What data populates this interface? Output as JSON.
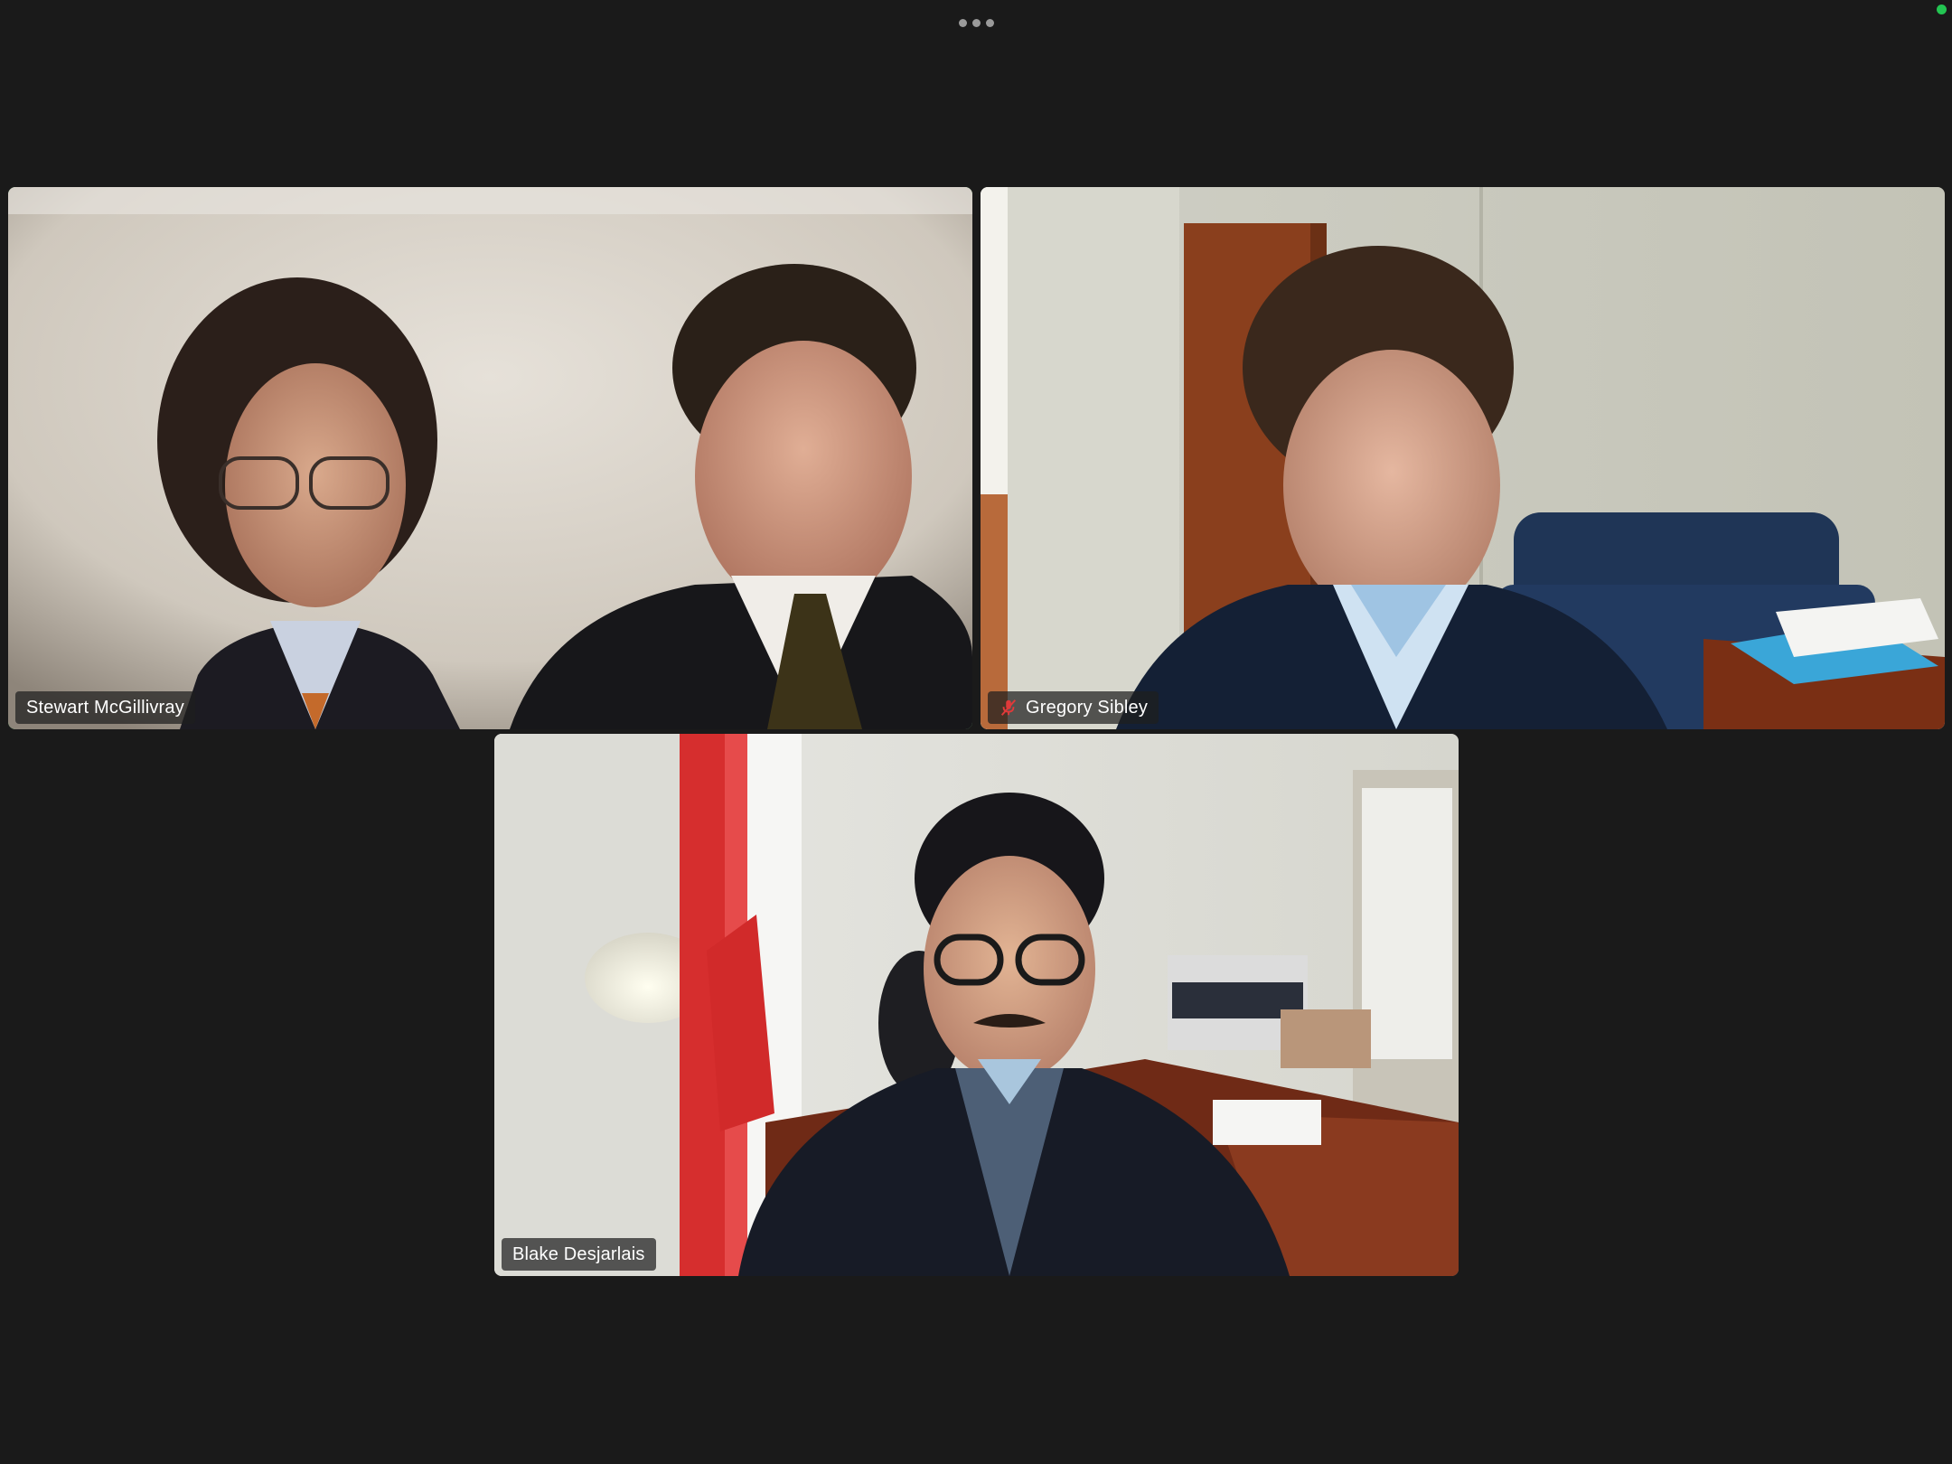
{
  "meeting": {
    "more_menu_icon": "more-horizontal-icon",
    "connection_indicator_color": "#23c552",
    "active_speaker_border_color": "#23c552"
  },
  "participants": [
    {
      "name": "Stewart McGillivray",
      "muted": false,
      "active_speaker": true
    },
    {
      "name": "Gregory Sibley",
      "muted": true,
      "active_speaker": false,
      "mic_icon": "mic-muted-icon"
    },
    {
      "name": "Blake Desjarlais",
      "muted": false,
      "active_speaker": false
    }
  ]
}
